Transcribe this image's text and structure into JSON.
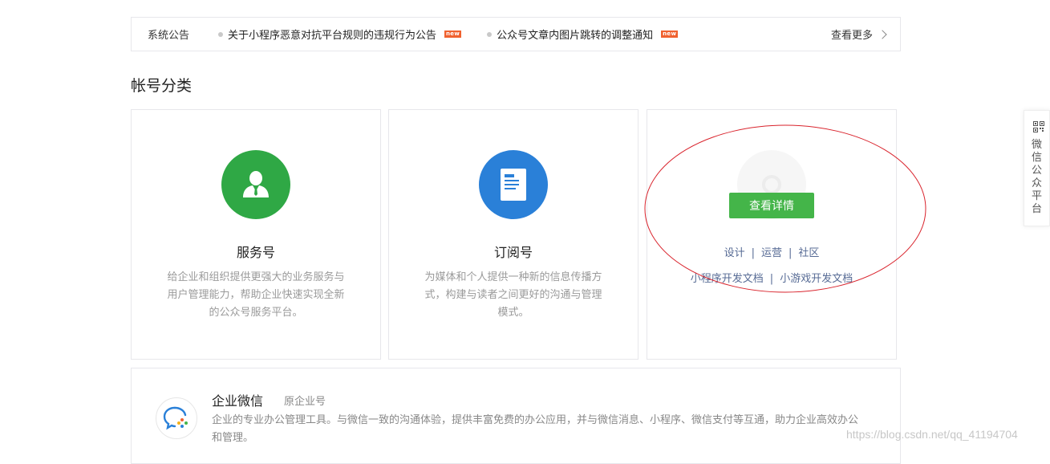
{
  "notices": {
    "title": "系统公告",
    "items": [
      {
        "text": "关于小程序恶意对抗平台规则的违规行为公告",
        "badge": "new"
      },
      {
        "text": "公众号文章内图片跳转的调整通知",
        "badge": "new"
      }
    ],
    "more": "查看更多"
  },
  "section_title": "帐号分类",
  "cards": [
    {
      "name": "服务号",
      "desc": "给企业和组织提供更强大的业务服务与用户管理能力，帮助企业快速实现全新的公众号服务平台。",
      "icon": "user-icon",
      "color": "#2fa845"
    },
    {
      "name": "订阅号",
      "desc": "为媒体和个人提供一种新的信息传播方式，构建与读者之间更好的沟通与管理模式。",
      "icon": "document-icon",
      "color": "#2a80d8"
    }
  ],
  "miniprogram": {
    "detail_button": "查看详情",
    "links_row1": [
      "设计",
      "运营",
      "社区"
    ],
    "links_row2": [
      "小程序开发文档",
      "小游戏开发文档"
    ],
    "separator": "|"
  },
  "wework": {
    "name": "企业微信",
    "sub": "原企业号",
    "desc": "企业的专业办公管理工具。与微信一致的沟通体验，提供丰富免费的办公应用，并与微信消息、小程序、微信支付等互通，助力企业高效办公和管理。"
  },
  "float_panel": {
    "text": "微信公众平台",
    "icon": "qr-code-icon"
  },
  "watermark": "https://blog.csdn.net/qq_41194704",
  "colors": {
    "green": "#44b549",
    "link": "#576b95",
    "annotation": "#d9232c"
  }
}
